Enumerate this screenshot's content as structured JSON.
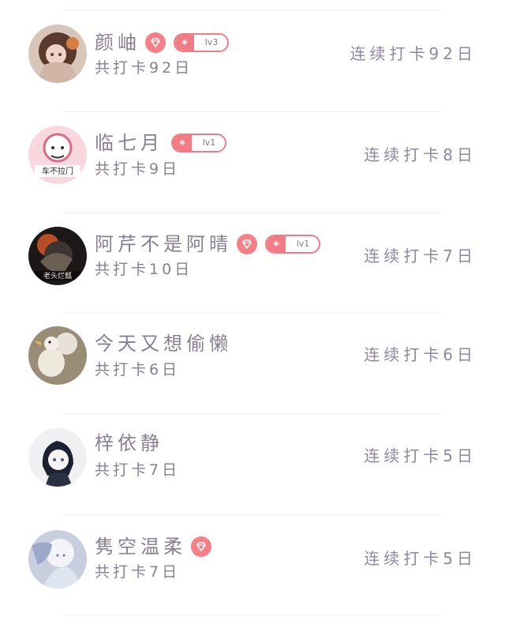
{
  "users": [
    {
      "name": "颜岫",
      "vip": true,
      "level": "lv3",
      "total": "共打卡92日",
      "streak": "连续打卡92日"
    },
    {
      "name": "临七月",
      "vip": false,
      "level": "lv1",
      "total": "共打卡9日",
      "streak": "连续打卡8日",
      "avatar_caption": "车不拉门"
    },
    {
      "name": "阿芹不是阿晴",
      "vip": true,
      "level": "lv1",
      "total": "共打卡10日",
      "streak": "连续打卡7日",
      "avatar_caption": "老头烂瓢"
    },
    {
      "name": "今天又想偷懒",
      "vip": false,
      "level": null,
      "total": "共打卡6日",
      "streak": "连续打卡6日"
    },
    {
      "name": "梓依静",
      "vip": false,
      "level": null,
      "total": "共打卡7日",
      "streak": "连续打卡5日"
    },
    {
      "name": "隽空温柔",
      "vip": true,
      "level": null,
      "total": "共打卡7日",
      "streak": "连续打卡5日"
    }
  ],
  "colors": {
    "accent": "#f57f87",
    "text": "#8a7e94",
    "divider": "#f1eef2"
  },
  "icons": {
    "vip": "diamond-icon",
    "level": "level-icon"
  }
}
